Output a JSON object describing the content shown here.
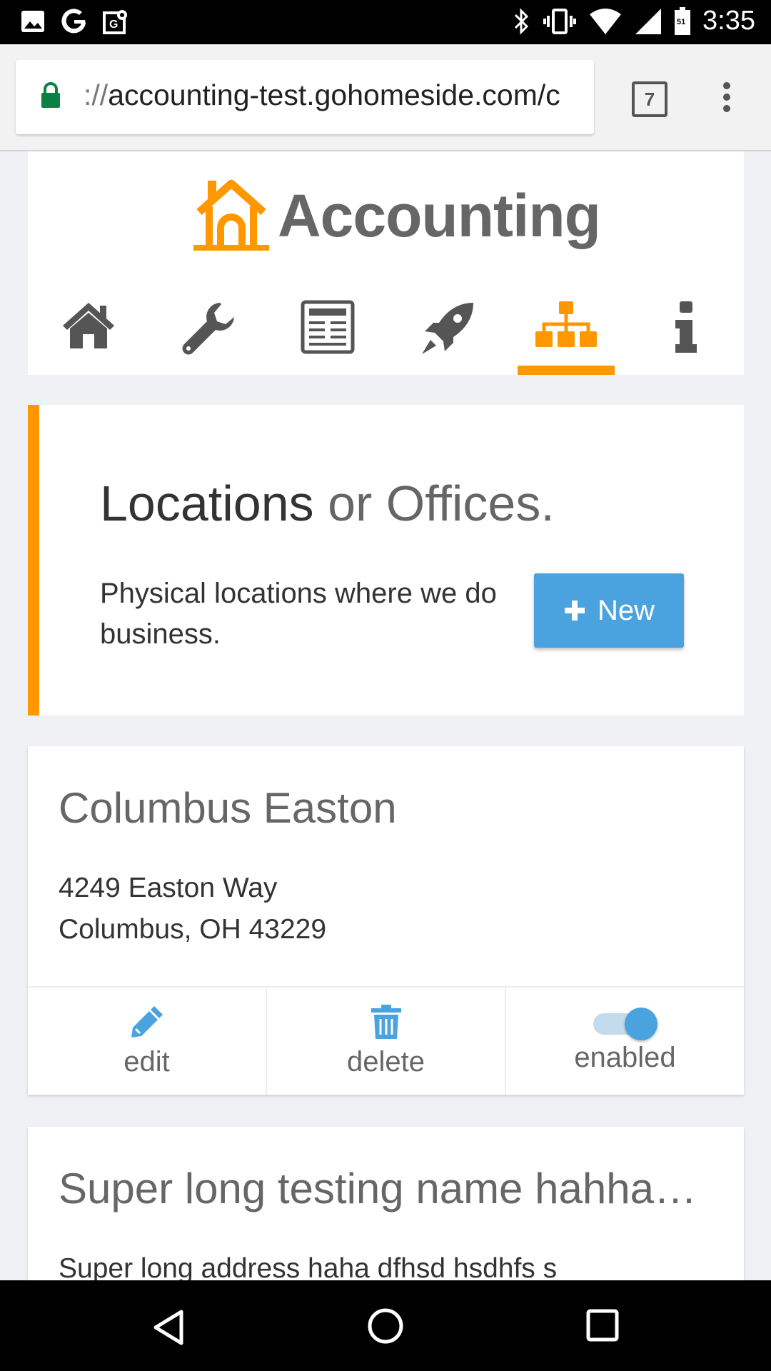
{
  "status_bar": {
    "time": "3:35",
    "battery_level": "51",
    "icons": [
      "image-icon",
      "google-icon",
      "maps-icon",
      "bluetooth-icon",
      "vibrate-icon",
      "wifi-icon",
      "signal-icon",
      "battery-icon"
    ]
  },
  "browser": {
    "url_scheme": "://",
    "url_host": "accounting-test.gohomeside.com/c",
    "tab_count": "7"
  },
  "header": {
    "logo_text": "Accounting",
    "nav_items": [
      {
        "name": "home",
        "icon": "home-icon"
      },
      {
        "name": "settings",
        "icon": "wrench-icon"
      },
      {
        "name": "reports",
        "icon": "newspaper-icon"
      },
      {
        "name": "launch",
        "icon": "rocket-icon"
      },
      {
        "name": "locations",
        "icon": "sitemap-icon",
        "active": true
      },
      {
        "name": "info",
        "icon": "info-icon"
      }
    ],
    "accent_color": "#ff9800"
  },
  "intro": {
    "title_main": "Locations",
    "title_rest": " or Offices.",
    "description": "Physical locations where we do business.",
    "new_button_label": "New"
  },
  "locations": [
    {
      "name": "Columbus Easton",
      "address_line1": "4249 Easton Way",
      "address_line2": "Columbus, OH 43229",
      "edit_label": "edit",
      "delete_label": "delete",
      "enabled_label": "enabled",
      "enabled": true
    },
    {
      "name": "Super long testing name hahhahahaha",
      "address_line1": "Super long address haha dfhsd hsdhfs s"
    }
  ],
  "colors": {
    "primary_blue": "#4aa3df",
    "accent_orange": "#ff9800",
    "background": "#eff1f5"
  }
}
